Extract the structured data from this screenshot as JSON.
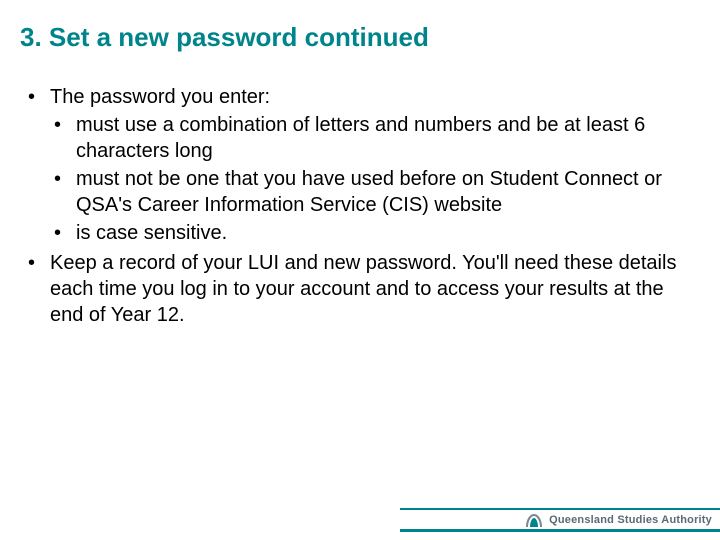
{
  "title": "3. Set a new password continued",
  "bullets": {
    "item1_intro": "The password you enter:",
    "sub1": "must use a combination of letters and numbers and be at least 6 characters long",
    "sub2": "must not be one that you have used before on Student Connect or QSA's Career Information Service (CIS) website",
    "sub3": "is case sensitive.",
    "item2": "Keep a record of your LUI and new password. You'll need these details each time you log in to your account and to access your results at the end of Year 12."
  },
  "footer": {
    "org": "Queensland Studies Authority"
  },
  "colors": {
    "accent": "#00848b"
  }
}
